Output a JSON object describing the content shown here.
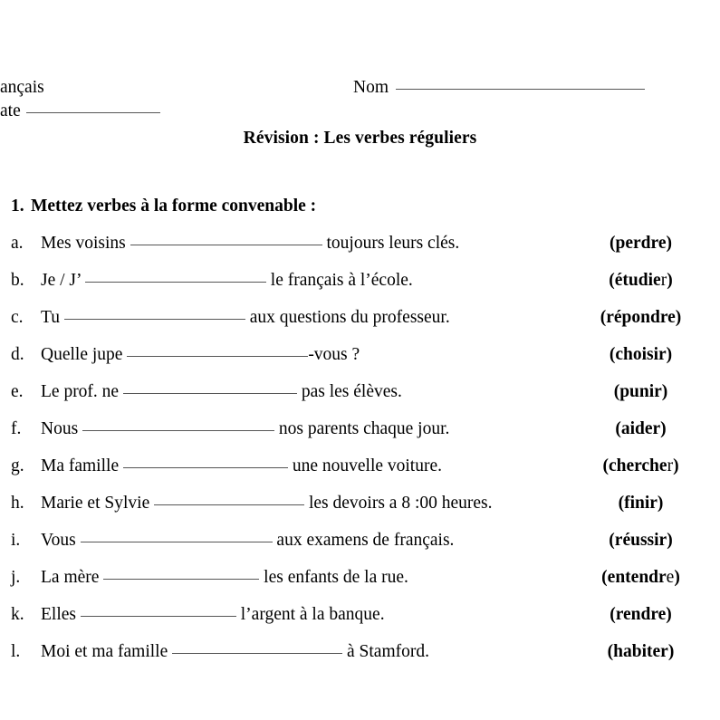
{
  "header": {
    "course_label": "ançais",
    "date_label": "ate",
    "name_label": "Nom"
  },
  "title": "Révision : Les verbes réguliers",
  "section": {
    "number": "1.",
    "heading": "Mettez verbes à la forme convenable :"
  },
  "items": [
    {
      "label": "a.",
      "before": "Mes voisins",
      "blank_width": 212,
      "after": "toujours leurs clés.",
      "verb_open": "(",
      "verb_bold": "perdre",
      "verb_tail": "",
      "verb_close": ")",
      "verb_offset": 0
    },
    {
      "label": "b.",
      "before": "Je / J’",
      "blank_width": 200,
      "after": "le français à l’école.",
      "verb_open": "(",
      "verb_bold": "étudie",
      "verb_tail": "r",
      "verb_close": ")",
      "verb_offset": 0
    },
    {
      "label": "c.",
      "before": "Tu",
      "blank_width": 200,
      "after": "aux questions du professeur.",
      "verb_open": "(",
      "verb_bold": "répondre",
      "verb_tail": "",
      "verb_close": ")",
      "verb_offset": 0
    },
    {
      "label": "d.",
      "before": "Quelle jupe",
      "blank_width": 200,
      "after": "-vous ?",
      "verb_open": "(",
      "verb_bold": "choisir",
      "verb_tail": "",
      "verb_close": ")",
      "verb_offset": 0
    },
    {
      "label": "e.",
      "before": "Le prof. ne",
      "blank_width": 192,
      "after": "pas les élèves.",
      "verb_open": "(",
      "verb_bold": "punir",
      "verb_tail": "",
      "verb_close": ")",
      "verb_offset": 0
    },
    {
      "label": "f.",
      "before": "Nous",
      "blank_width": 212,
      "after": "nos parents chaque jour.",
      "verb_open": "(",
      "verb_bold": "aider",
      "verb_tail": "",
      "verb_close": ")",
      "verb_offset": 0
    },
    {
      "label": "g.",
      "before": "Ma famille",
      "blank_width": 182,
      "after": "une nouvelle voiture.",
      "verb_open": "(",
      "verb_bold": "cherche",
      "verb_tail": "r",
      "verb_close": ")",
      "verb_offset": 0
    },
    {
      "label": "h.",
      "before": "Marie et Sylvie",
      "blank_width": 166,
      "after": "les devoirs a 8 :00 heures.",
      "verb_open": "(",
      "verb_bold": "finir",
      "verb_tail": "",
      "verb_close": ")",
      "verb_offset": 0
    },
    {
      "label": "i.",
      "before": "Vous",
      "blank_width": 212,
      "after": "aux examens de français.",
      "verb_open": "(",
      "verb_bold": "réussir",
      "verb_tail": "",
      "verb_close": ")",
      "verb_offset": 0
    },
    {
      "label": "j.",
      "before": "La mère",
      "blank_width": 172,
      "after": "les enfants de la rue.",
      "verb_open": "(",
      "verb_bold": "entendr",
      "verb_tail": "e",
      "verb_close": ")",
      "verb_offset": 0
    },
    {
      "label": "k.",
      "before": "Elles",
      "blank_width": 172,
      "after": "l’argent à la banque.",
      "verb_open": "(",
      "verb_bold": "rendre",
      "verb_tail": "",
      "verb_close": ")",
      "verb_offset": 0
    },
    {
      "label": "l.",
      "before": "Moi et ma famille",
      "blank_width": 188,
      "after": "à Stamford.",
      "verb_open": "(",
      "verb_bold": "habiter",
      "verb_tail": "",
      "verb_close": ")",
      "verb_offset": 0
    }
  ]
}
